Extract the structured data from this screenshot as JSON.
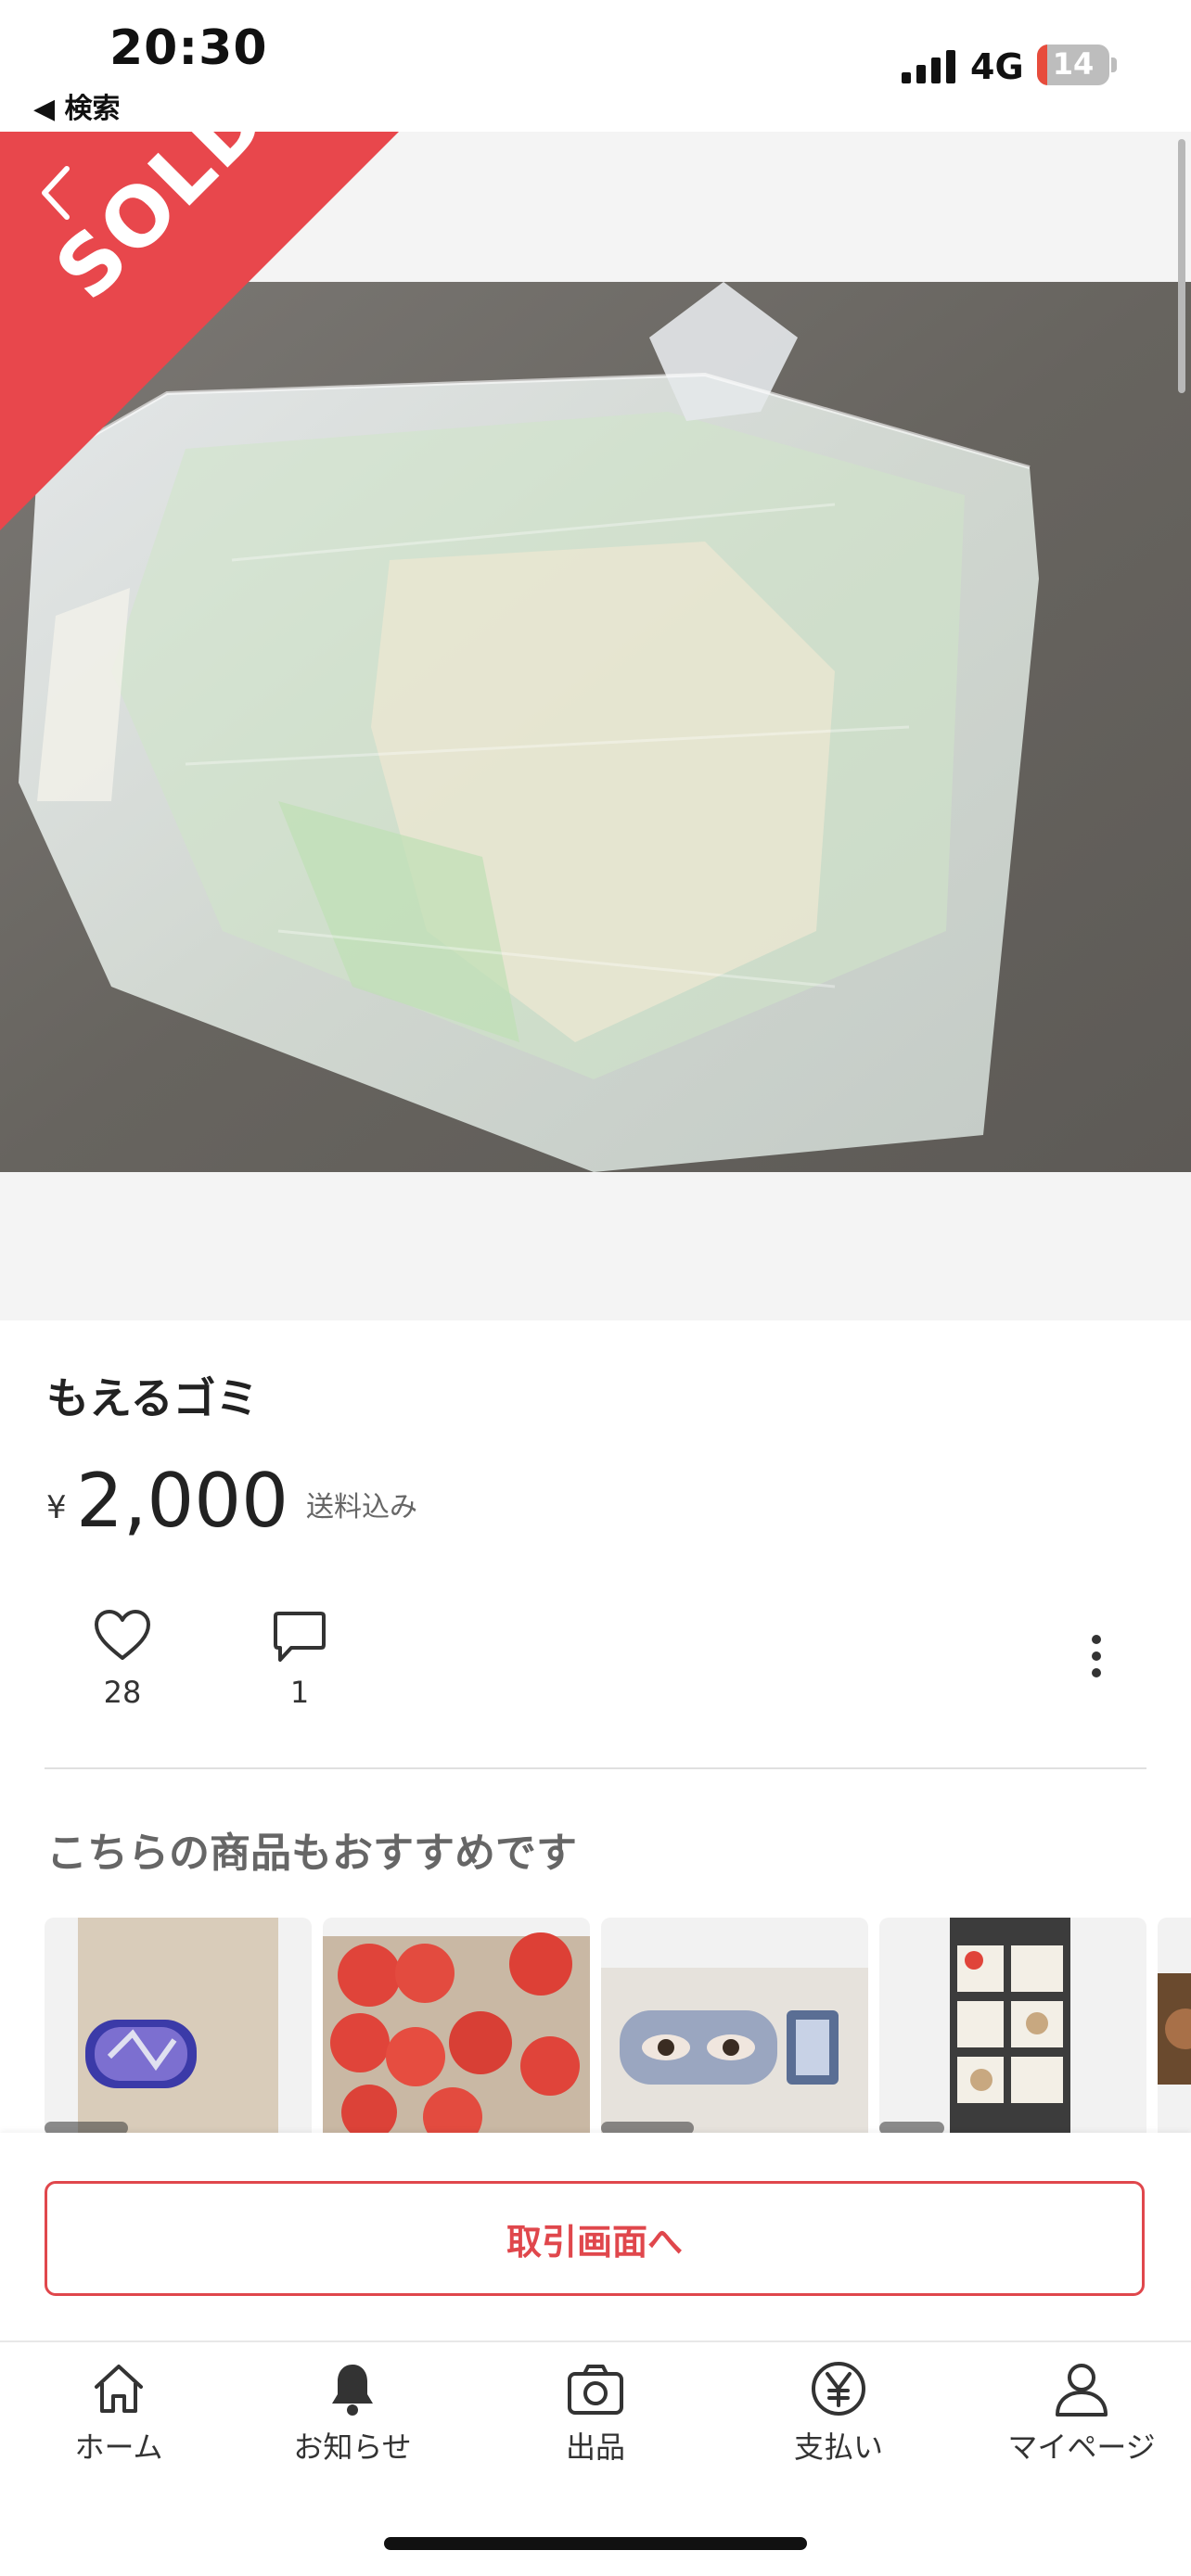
{
  "status_bar": {
    "time": "20:30",
    "back_label": "◀ 検索",
    "network": "4G",
    "battery": "14"
  },
  "product": {
    "sold_label": "SOLD",
    "title": "もえるゴミ",
    "currency": "¥",
    "price": "2,000",
    "shipping": "送料込み",
    "likes": "28",
    "comments": "1"
  },
  "recommendations": {
    "heading": "こちらの商品もおすすめです"
  },
  "actions": {
    "trade_button": "取引画面へ"
  },
  "tab_bar": {
    "items": [
      {
        "label": "ホーム",
        "icon": "home-icon"
      },
      {
        "label": "お知らせ",
        "icon": "bell-icon"
      },
      {
        "label": "出品",
        "icon": "camera-icon"
      },
      {
        "label": "支払い",
        "icon": "yen-icon"
      },
      {
        "label": "マイページ",
        "icon": "person-icon"
      }
    ]
  },
  "colors": {
    "accent": "#e0474c",
    "sold_banner": "#e8474c"
  }
}
